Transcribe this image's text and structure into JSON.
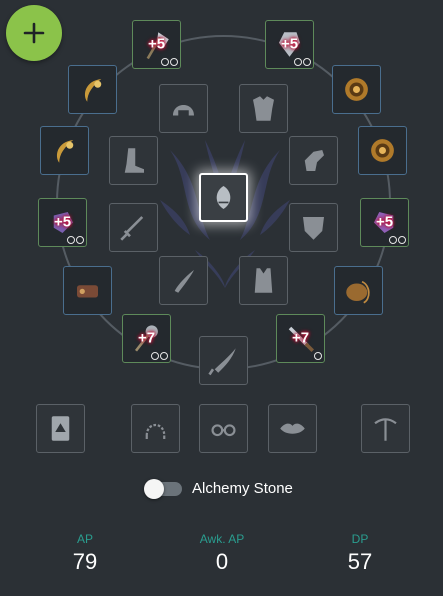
{
  "add_button": {
    "icon": "plus-icon"
  },
  "slots": {
    "main_weapon": {
      "icon": "ax-icon",
      "enhancement": "+5",
      "dots": 2
    },
    "off_weapon": {
      "icon": "ornament-icon",
      "enhancement": "+5",
      "dots": 2
    },
    "left_gloves": {
      "icon": "gauntlet-icon",
      "enhancement": "+5",
      "dots": 2
    },
    "right_gloves": {
      "icon": "gauntlet-icon",
      "enhancement": "+5",
      "dots": 2
    },
    "lower_left": {
      "icon": "mace-icon",
      "enhancement": "+7",
      "dots": 2
    },
    "lower_right": {
      "icon": "dagger-icon",
      "enhancement": "+7",
      "dots": 1
    }
  },
  "toggle": {
    "label": "Alchemy Stone",
    "on": false
  },
  "stats": {
    "ap": {
      "label": "AP",
      "value": "79"
    },
    "awk_ap": {
      "label": "Awk. AP",
      "value": "0"
    },
    "dp": {
      "label": "DP",
      "value": "57"
    }
  },
  "colors": {
    "accent": "#8bc34a",
    "stat_label": "#2a9d8f",
    "enhance_glow": "#c0143c"
  }
}
